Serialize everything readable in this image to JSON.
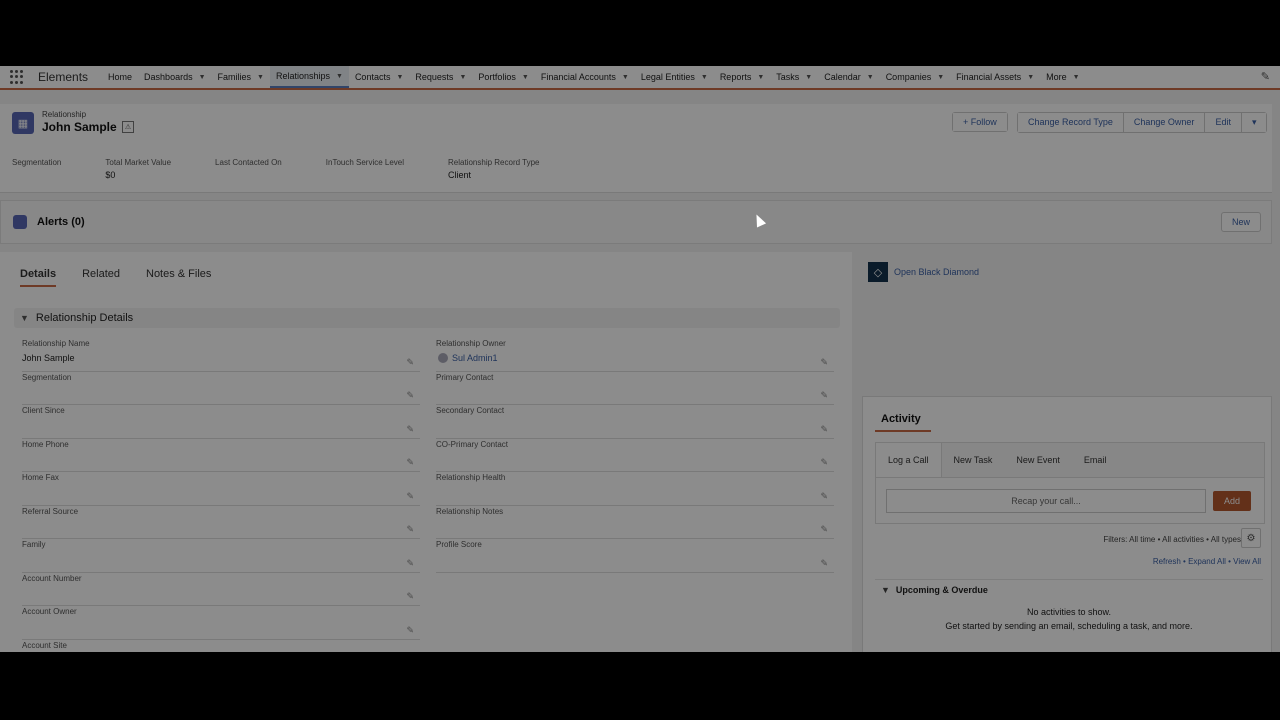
{
  "nav": {
    "app_name": "Elements",
    "items": [
      {
        "label": "Home",
        "dropdown": false
      },
      {
        "label": "Dashboards",
        "dropdown": true
      },
      {
        "label": "Families",
        "dropdown": true
      },
      {
        "label": "Relationships",
        "dropdown": true,
        "active": true
      },
      {
        "label": "Contacts",
        "dropdown": true
      },
      {
        "label": "Requests",
        "dropdown": true
      },
      {
        "label": "Portfolios",
        "dropdown": true
      },
      {
        "label": "Financial Accounts",
        "dropdown": true
      },
      {
        "label": "Legal Entities",
        "dropdown": true
      },
      {
        "label": "Reports",
        "dropdown": true
      },
      {
        "label": "Tasks",
        "dropdown": true
      },
      {
        "label": "Calendar",
        "dropdown": true
      },
      {
        "label": "Companies",
        "dropdown": true
      },
      {
        "label": "Financial Assets",
        "dropdown": true
      },
      {
        "label": "More",
        "dropdown": true
      }
    ]
  },
  "header": {
    "object_label": "Relationship",
    "record_name": "John Sample",
    "follow_label": "Follow",
    "actions": [
      "Change Record Type",
      "Change Owner",
      "Edit"
    ],
    "fields": [
      {
        "label": "Segmentation",
        "value": ""
      },
      {
        "label": "Total Market Value",
        "value": "$0"
      },
      {
        "label": "Last Contacted On",
        "value": ""
      },
      {
        "label": "InTouch Service Level",
        "value": ""
      },
      {
        "label": "Relationship Record Type",
        "value": "Client"
      }
    ]
  },
  "alerts": {
    "title": "Alerts (0)",
    "new_label": "New"
  },
  "tabs": [
    "Details",
    "Related",
    "Notes & Files"
  ],
  "details": {
    "section_title": "Relationship Details",
    "left_fields": [
      {
        "label": "Relationship Name",
        "value": "John Sample"
      },
      {
        "label": "Segmentation",
        "value": ""
      },
      {
        "label": "Client Since",
        "value": ""
      },
      {
        "label": "Home Phone",
        "value": ""
      },
      {
        "label": "Home Fax",
        "value": ""
      },
      {
        "label": "Referral Source",
        "value": ""
      },
      {
        "label": "Family",
        "value": ""
      },
      {
        "label": "Account Number",
        "value": ""
      },
      {
        "label": "Account Owner",
        "value": ""
      },
      {
        "label": "Account Site",
        "value": ""
      }
    ],
    "right_fields": [
      {
        "label": "Relationship Owner",
        "value": "Sul Admin1"
      },
      {
        "label": "Primary Contact",
        "value": ""
      },
      {
        "label": "Secondary Contact",
        "value": ""
      },
      {
        "label": "CO-Primary Contact",
        "value": ""
      },
      {
        "label": "Relationship Health",
        "value": ""
      },
      {
        "label": "Relationship Notes",
        "value": ""
      },
      {
        "label": "Profile Score",
        "value": ""
      }
    ]
  },
  "sidebar": {
    "link_label": "Open Black Diamond"
  },
  "activity": {
    "title": "Activity",
    "tabs": [
      "Log a Call",
      "New Task",
      "New Event",
      "Email"
    ],
    "input_placeholder": "Recap your call...",
    "add_label": "Add",
    "filters_text": "Filters: All time • All activities • All types",
    "refresh_text": "Refresh • Expand All • View All",
    "upcoming_title": "Upcoming & Overdue",
    "empty_line1": "No activities to show.",
    "empty_line2": "Get started by sending an email, scheduling a task, and more."
  }
}
